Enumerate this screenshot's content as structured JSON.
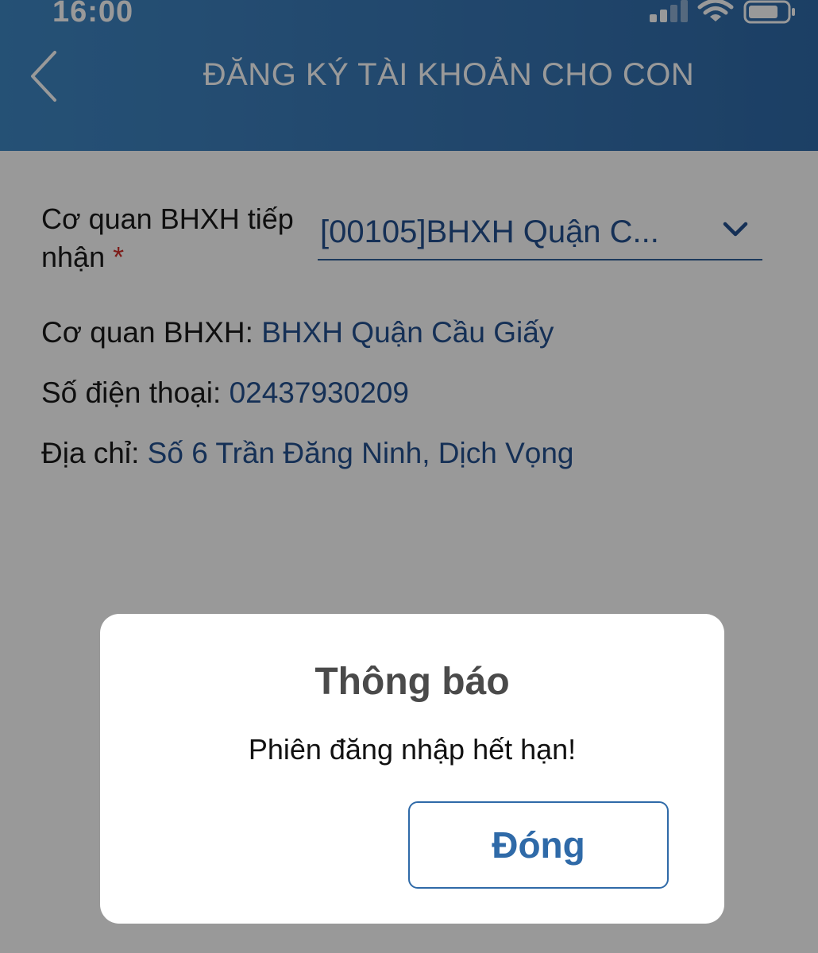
{
  "status_bar": {
    "time": "16:00",
    "icons": [
      "signal-icon",
      "wifi-icon",
      "battery-icon"
    ]
  },
  "header": {
    "title": "ĐĂNG KÝ TÀI KHOẢN CHO CON",
    "back_icon": "chevron-left-icon"
  },
  "form": {
    "agency_label": "Cơ quan BHXH tiếp nhận",
    "required_mark": "*",
    "agency_select_value": "[00105]BHXH Quận C...",
    "agency_info_label": "Cơ quan BHXH:",
    "agency_info_value": "BHXH Quận Cầu Giấy",
    "phone_label": "Số điện thoại:",
    "phone_value": "02437930209",
    "address_label": "Địa chỉ:",
    "address_value": "Số 6 Trần Đăng Ninh, Dịch Vọng"
  },
  "dialog": {
    "title": "Thông báo",
    "message": "Phiên đăng nhập hết hạn!",
    "close_label": "Đóng"
  },
  "colors": {
    "header_start": "#3f87c4",
    "header_end": "#2f6aa8",
    "value_text": "#24508f",
    "required": "#d0302a",
    "button_accent": "#2f6aa8"
  }
}
